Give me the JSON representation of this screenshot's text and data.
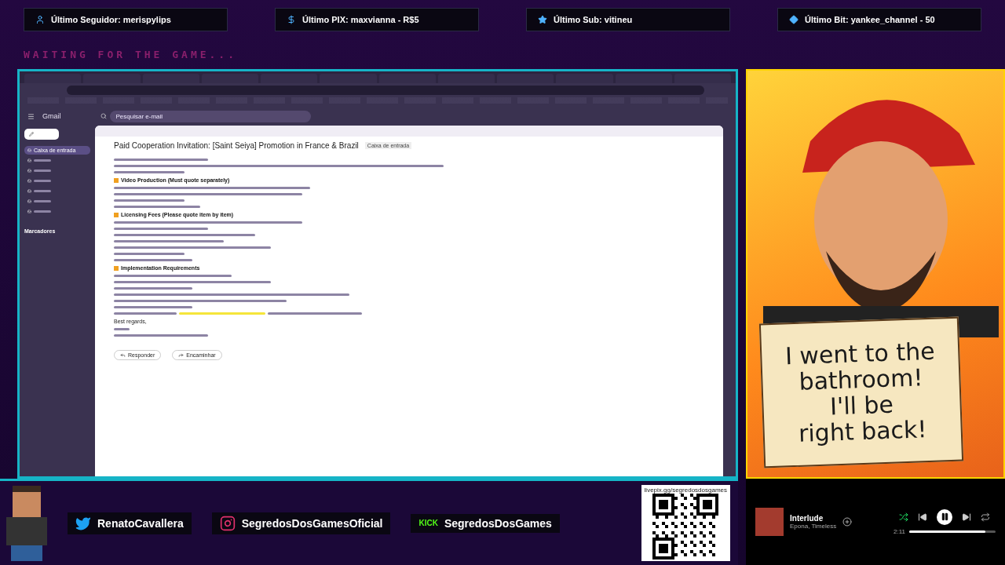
{
  "alerts": [
    {
      "kind": "follower",
      "label": "Último Seguidor: merispylips"
    },
    {
      "kind": "pix",
      "label": "Último PIX: maxvianna - R$5"
    },
    {
      "kind": "sub",
      "label": "Último Sub: vitineu"
    },
    {
      "kind": "bit",
      "label": "Último Bit: yankee_channel - 50"
    }
  ],
  "banner": "WAITING FOR THE GAME...",
  "gmail": {
    "app_name": "Gmail",
    "search": {
      "placeholder": "Pesquisar e-mail"
    },
    "sidebar": {
      "items": [
        {
          "label": "Caixa de entrada",
          "selected": true
        },
        {
          "selected": false
        },
        {
          "selected": false
        },
        {
          "selected": false
        },
        {
          "selected": false
        },
        {
          "selected": false
        },
        {
          "selected": false
        }
      ],
      "section": "Marcadores"
    },
    "email": {
      "subject": "Paid Cooperation Invitation: [Saint Seiya] Promotion in France & Brazil",
      "tag": "Caixa de entrada",
      "body": [
        {
          "kind": "line"
        },
        {
          "kind": "line"
        },
        {
          "kind": "line"
        },
        {
          "kind": "heading",
          "text": "Video Production (Must quote separately)"
        },
        {
          "kind": "line"
        },
        {
          "kind": "line"
        },
        {
          "kind": "line"
        },
        {
          "kind": "line"
        },
        {
          "kind": "heading",
          "text": "Licensing Fees (Please quote item by item)"
        },
        {
          "kind": "line"
        },
        {
          "kind": "line"
        },
        {
          "kind": "line"
        },
        {
          "kind": "line"
        },
        {
          "kind": "line"
        },
        {
          "kind": "line"
        },
        {
          "kind": "line"
        },
        {
          "kind": "heading",
          "text": "Implementation Requirements"
        },
        {
          "kind": "line"
        },
        {
          "kind": "line"
        },
        {
          "kind": "line"
        },
        {
          "kind": "line"
        },
        {
          "kind": "line"
        },
        {
          "kind": "line"
        },
        {
          "kind": "highlight"
        },
        {
          "kind": "text",
          "text": "Best regards,"
        },
        {
          "kind": "line"
        },
        {
          "kind": "line"
        }
      ],
      "actions": [
        "Responder",
        "Encaminhar"
      ]
    }
  },
  "sign": {
    "lines": [
      "I went to the",
      "bathroom!",
      "I'll be",
      "right back!"
    ]
  },
  "socials": [
    {
      "kind": "twitter",
      "handle": "RenatoCavallera"
    },
    {
      "kind": "instagram",
      "handle": "SegredosDosGamesOficial"
    },
    {
      "kind": "kick",
      "badge": "KICK",
      "handle": "SegredosDosGames"
    }
  ],
  "qr": {
    "url": "livepix.gg/segredosdosgames"
  },
  "player": {
    "title": "Interlude",
    "artist": "Epona, Timeless",
    "elapsed": "2:11",
    "level": 0.88,
    "playing": true,
    "shuffle": true
  }
}
